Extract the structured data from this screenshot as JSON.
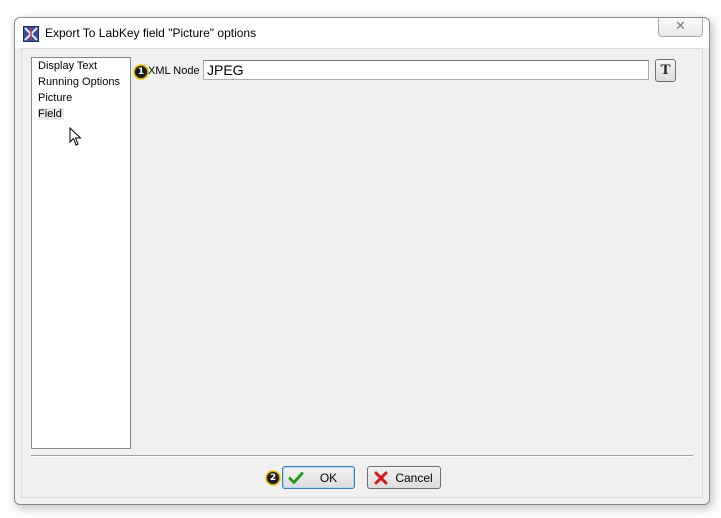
{
  "window": {
    "title": "Export To LabKey field \"Picture\" options",
    "close_icon": "close-icon",
    "app_icon": "app-logo-icon"
  },
  "sidebar": {
    "items": [
      {
        "label": "Display Text",
        "selected": false
      },
      {
        "label": "Running Options",
        "selected": false
      },
      {
        "label": "Picture",
        "selected": false
      },
      {
        "label": "Field",
        "selected": true
      }
    ]
  },
  "field": {
    "help_badge": "1",
    "label": "XML Node",
    "value": "JPEG",
    "text_button_label": "T"
  },
  "footer": {
    "help_badge": "2",
    "ok_label": "OK",
    "cancel_label": "Cancel"
  },
  "colors": {
    "window_bg": "#f0f0f0",
    "ok_check": "#1e9e1e",
    "cancel_x": "#d11a1a",
    "badge_ring": "#f3d34a"
  }
}
